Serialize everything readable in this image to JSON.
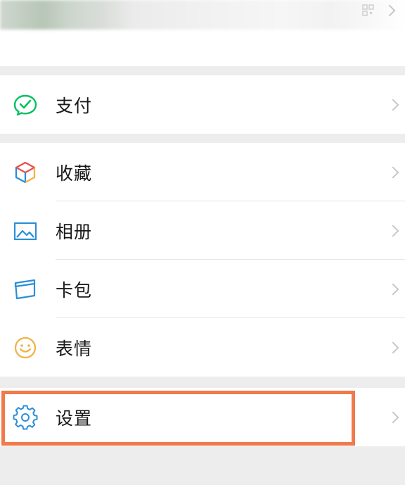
{
  "profile": {
    "qr_icon": "qr-code-icon",
    "chevron_icon": "chevron-right-icon"
  },
  "menu": {
    "pay": {
      "label": "支付",
      "icon": "wechat-pay-icon",
      "color": "#07c160"
    },
    "favorites": {
      "label": "收藏",
      "icon": "favorites-cube-icon"
    },
    "album": {
      "label": "相册",
      "icon": "album-picture-icon",
      "color": "#2a8fd8"
    },
    "cards": {
      "label": "卡包",
      "icon": "card-wallet-icon",
      "color": "#2a8fd8"
    },
    "stickers": {
      "label": "表情",
      "icon": "smiley-face-icon",
      "color": "#f0b348"
    },
    "settings": {
      "label": "设置",
      "icon": "gear-icon",
      "color": "#2a8fd8"
    }
  },
  "highlight_color": "#f07a4b"
}
